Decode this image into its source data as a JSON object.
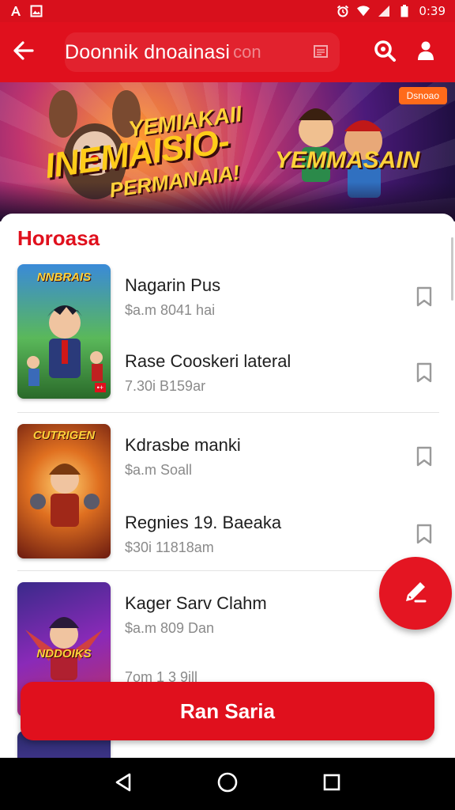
{
  "status_bar": {
    "time": "0:39",
    "icons": [
      "font-icon",
      "image-icon",
      "alarm-icon",
      "wifi-icon",
      "signal-icon",
      "battery-icon"
    ]
  },
  "app_bar": {
    "search_value": "Doonnik dnoainasi",
    "search_placeholder": "con",
    "icons": [
      "back-arrow-icon",
      "document-icon",
      "search-icon",
      "profile-icon"
    ]
  },
  "banner": {
    "tag": "Dsnoao",
    "line1": "YEMIAKAII",
    "line2": "INEMAISIO-",
    "line3": "PERMANAIA!",
    "line4": "YEMMASAIN"
  },
  "section": {
    "title": "Horoasa"
  },
  "groups": [
    {
      "cover_title": "NNBRAIS",
      "cover_badge": "•+",
      "items": [
        {
          "title": "Nagarin Pus",
          "subtitle": "$a.m 8041 hai"
        },
        {
          "title": "Rase Cooskeri lateral",
          "subtitle": "7.30i B159ar"
        }
      ]
    },
    {
      "cover_title": "CUTRIGEN",
      "cover_badge": "",
      "items": [
        {
          "title": "Kdrasbe manki",
          "subtitle": "$a.m Soall"
        },
        {
          "title": "Regnies 19. Baeaka",
          "subtitle": "$30i 11818am"
        }
      ]
    },
    {
      "cover_title": "NDDOIKS",
      "cover_badge": "",
      "items": [
        {
          "title": "Kager Sarv Clahm",
          "subtitle": "$a.m 809 Dan"
        },
        {
          "title": "",
          "subtitle": "7om 1 3 9ill"
        }
      ]
    }
  ],
  "cta": {
    "label": "Ran Saria"
  },
  "colors": {
    "primary": "#e0101d",
    "title_text": "#1e1e1e",
    "sub_text": "#8a8a8a"
  },
  "nav_bar": {
    "icons": [
      "back-triangle-icon",
      "home-circle-icon",
      "recents-square-icon"
    ]
  }
}
